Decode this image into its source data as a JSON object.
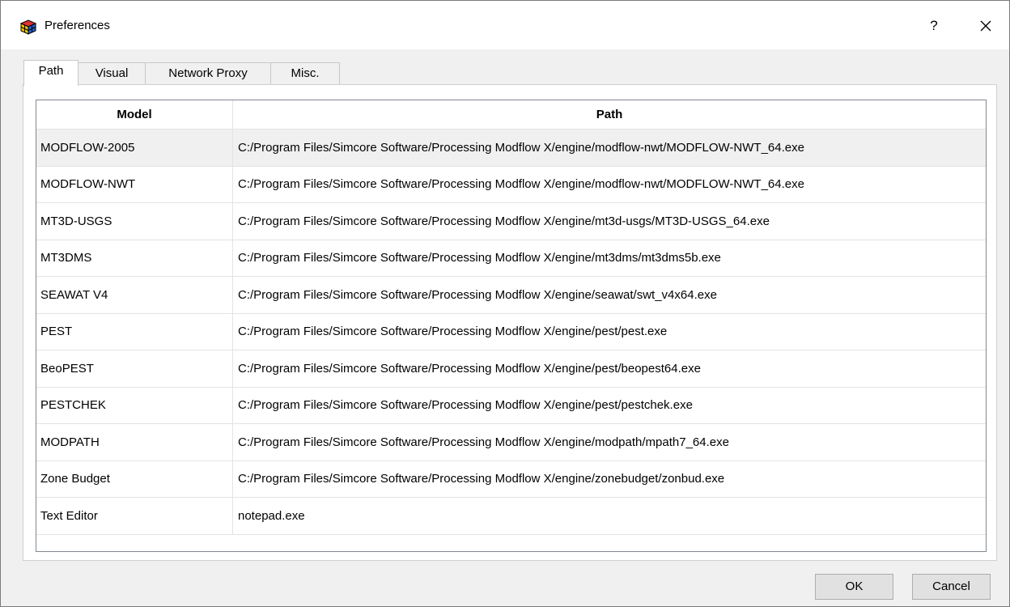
{
  "window": {
    "title": "Preferences",
    "help_label": "?",
    "close_label": "✕"
  },
  "tabs": [
    {
      "label": "Path",
      "active": true
    },
    {
      "label": "Visual",
      "active": false
    },
    {
      "label": "Network Proxy",
      "active": false
    },
    {
      "label": "Misc.",
      "active": false
    }
  ],
  "table": {
    "headers": {
      "model": "Model",
      "path": "Path"
    },
    "rows": [
      {
        "model": "MODFLOW-2005",
        "path": "C:/Program Files/Simcore Software/Processing Modflow X/engine/modflow-nwt/MODFLOW-NWT_64.exe",
        "selected": true
      },
      {
        "model": "MODFLOW-NWT",
        "path": "C:/Program Files/Simcore Software/Processing Modflow X/engine/modflow-nwt/MODFLOW-NWT_64.exe"
      },
      {
        "model": "MT3D-USGS",
        "path": "C:/Program Files/Simcore Software/Processing Modflow X/engine/mt3d-usgs/MT3D-USGS_64.exe"
      },
      {
        "model": "MT3DMS",
        "path": "C:/Program Files/Simcore Software/Processing Modflow X/engine/mt3dms/mt3dms5b.exe"
      },
      {
        "model": "SEAWAT V4",
        "path": "C:/Program Files/Simcore Software/Processing Modflow X/engine/seawat/swt_v4x64.exe"
      },
      {
        "model": "PEST",
        "path": "C:/Program Files/Simcore Software/Processing Modflow X/engine/pest/pest.exe"
      },
      {
        "model": "BeoPEST",
        "path": "C:/Program Files/Simcore Software/Processing Modflow X/engine/pest/beopest64.exe"
      },
      {
        "model": "PESTCHEK",
        "path": "C:/Program Files/Simcore Software/Processing Modflow X/engine/pest/pestchek.exe"
      },
      {
        "model": "MODPATH",
        "path": "C:/Program Files/Simcore Software/Processing Modflow X/engine/modpath/mpath7_64.exe"
      },
      {
        "model": "Zone Budget",
        "path": "C:/Program Files/Simcore Software/Processing Modflow X/engine/zonebudget/zonbud.exe"
      },
      {
        "model": "Text Editor",
        "path": "notepad.exe"
      }
    ]
  },
  "buttons": {
    "ok": "OK",
    "cancel": "Cancel"
  }
}
